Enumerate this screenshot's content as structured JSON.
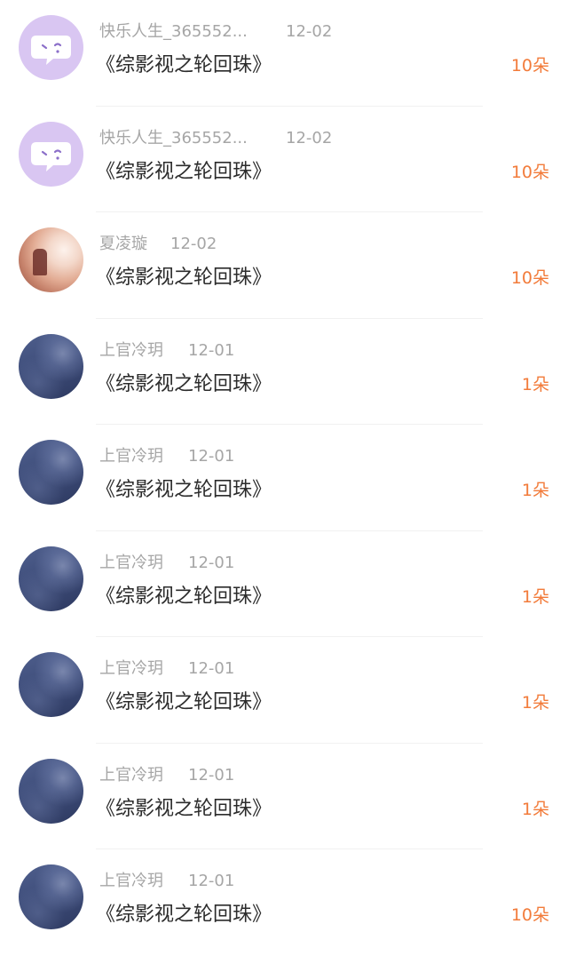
{
  "gift_records": [
    {
      "user": "快乐人生_365552...",
      "date": "12-02",
      "book": "《综影视之轮回珠》",
      "amount": "10朵",
      "avatar": "chat-bubble-avatar"
    },
    {
      "user": "快乐人生_365552...",
      "date": "12-02",
      "book": "《综影视之轮回珠》",
      "amount": "10朵",
      "avatar": "chat-bubble-avatar"
    },
    {
      "user": "夏凌璇",
      "date": "12-02",
      "book": "《综影视之轮回珠》",
      "amount": "10朵",
      "avatar": "sunset-photo-avatar"
    },
    {
      "user": "上官冷玥",
      "date": "12-01",
      "book": "《综影视之轮回珠》",
      "amount": "1朵",
      "avatar": "night-sky-avatar"
    },
    {
      "user": "上官冷玥",
      "date": "12-01",
      "book": "《综影视之轮回珠》",
      "amount": "1朵",
      "avatar": "night-sky-avatar"
    },
    {
      "user": "上官冷玥",
      "date": "12-01",
      "book": "《综影视之轮回珠》",
      "amount": "1朵",
      "avatar": "night-sky-avatar"
    },
    {
      "user": "上官冷玥",
      "date": "12-01",
      "book": "《综影视之轮回珠》",
      "amount": "1朵",
      "avatar": "night-sky-avatar"
    },
    {
      "user": "上官冷玥",
      "date": "12-01",
      "book": "《综影视之轮回珠》",
      "amount": "1朵",
      "avatar": "night-sky-avatar"
    },
    {
      "user": "上官冷玥",
      "date": "12-01",
      "book": "《综影视之轮回珠》",
      "amount": "10朵",
      "avatar": "night-sky-avatar"
    }
  ],
  "colors": {
    "username": "#a6a6a6",
    "title": "#2b2b2b",
    "amount_accent": "#f27b3a",
    "chat_avatar_bg": "#d9c6f2"
  }
}
